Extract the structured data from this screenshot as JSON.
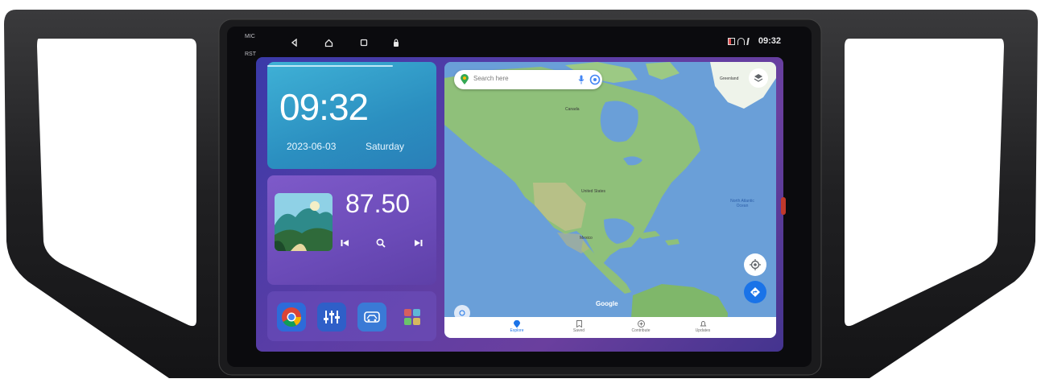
{
  "status_bar": {
    "left_labels": [
      "MIC",
      "RST"
    ],
    "time": "09:32"
  },
  "nav_bar": {
    "items": [
      "back-icon",
      "home-icon",
      "recents-icon",
      "lock-icon"
    ]
  },
  "clock_widget": {
    "time": "09:32",
    "date": "2023-06-03",
    "weekday": "Saturday"
  },
  "radio_widget": {
    "frequency": "87.50",
    "controls": [
      "previous-icon",
      "search-icon",
      "next-icon"
    ]
  },
  "dock": {
    "apps": [
      "chrome-icon",
      "equalizer-icon",
      "car-settings-icon",
      "apps-grid-icon"
    ]
  },
  "map": {
    "search_placeholder": "Search here",
    "tabs": [
      "Explore",
      "Saved",
      "Contribute",
      "Updates"
    ],
    "logo": "Google",
    "labels": [
      "Canada",
      "Greenland",
      "United States",
      "Mexico",
      "North Atlantic Ocean"
    ]
  },
  "colors": {
    "clock_card": "#2b8fc0",
    "radio_card": "#6b4bb8",
    "desktop": "#5b3da6",
    "map_water": "#6a9fd8",
    "map_land": "#8fc07a"
  }
}
